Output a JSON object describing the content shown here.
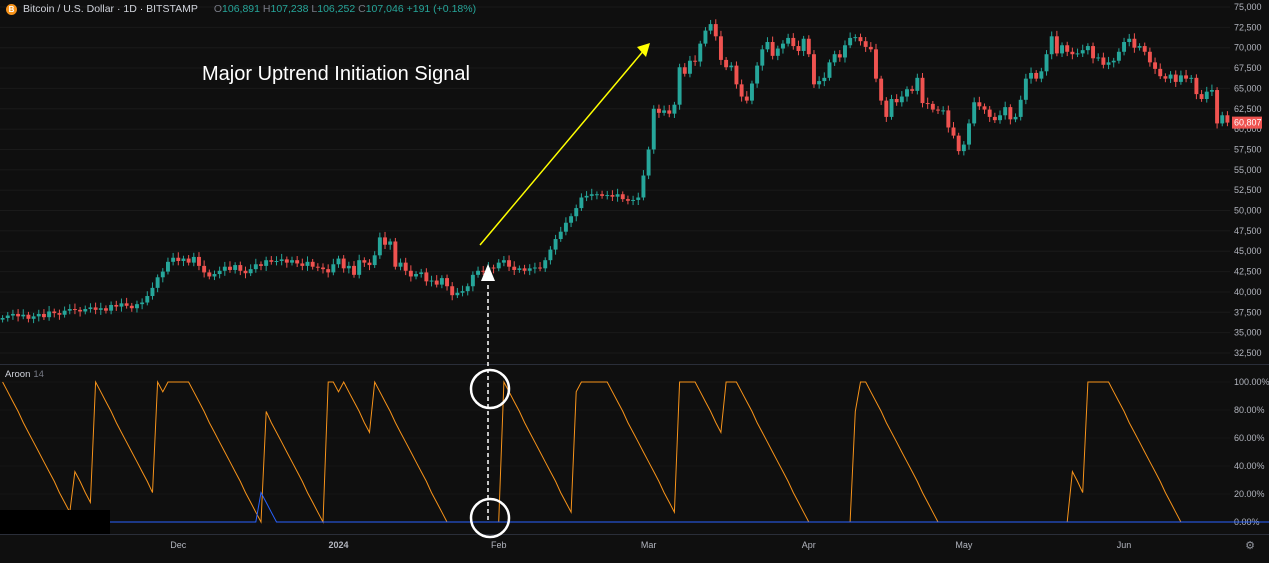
{
  "header": {
    "symbol": "Bitcoin / U.S. Dollar · 1D · BITSTAMP",
    "logo": "B",
    "open_key": "O",
    "open": "106,891",
    "high_key": "H",
    "high": "107,238",
    "low_key": "L",
    "low": "106,252",
    "close_key": "C",
    "close": "107,046",
    "change": "+191 (+0.18%)"
  },
  "annotation": {
    "title": "Major Uptrend Initiation Signal"
  },
  "aroon": {
    "label": "Aroon",
    "length": "14"
  },
  "icons": {
    "settings": "gear-icon"
  },
  "colors": {
    "background": "#0f0f0f",
    "up": "#26a69a",
    "down": "#ef5350",
    "aroon_up": "#f7931a",
    "aroon_down": "#2962ff",
    "arrow": "#ffff00",
    "last_price_bg": "#ef5350"
  },
  "chart_data": [
    {
      "type": "candlestick",
      "series_name": "Bitcoin / U.S. Dollar",
      "x_axis_labels": [
        "Dec",
        "2024",
        "Feb",
        "Mar",
        "Apr",
        "May",
        "Jun"
      ],
      "y_ticks": [
        32500,
        35000,
        37500,
        40000,
        42500,
        45000,
        47500,
        50000,
        52500,
        55000,
        57500,
        60000,
        62500,
        65000,
        67500,
        70000,
        72500,
        75000
      ],
      "y_tick_labels": [
        "32,500",
        "35,000",
        "37,500",
        "40,000",
        "42,500",
        "45,000",
        "47,500",
        "50,000",
        "52,500",
        "55,000",
        "57,500",
        "60,000",
        "62,500",
        "65,000",
        "67,500",
        "70,000",
        "72,500",
        "75,000"
      ],
      "ylim": [
        31000,
        77000
      ],
      "last_price": "60,807",
      "closes": [
        36800,
        37100,
        37300,
        37000,
        37200,
        36700,
        37000,
        37300,
        36900,
        37600,
        37400,
        37200,
        37700,
        37900,
        37800,
        37600,
        37900,
        38100,
        37800,
        38000,
        37700,
        38400,
        38200,
        38600,
        38300,
        38000,
        38500,
        38700,
        39500,
        40500,
        41800,
        42500,
        43700,
        44200,
        43800,
        44100,
        43600,
        44300,
        43200,
        42400,
        41900,
        42200,
        42600,
        43100,
        42700,
        43300,
        42600,
        42300,
        42800,
        43400,
        43200,
        43900,
        43700,
        43800,
        44000,
        43600,
        43900,
        43500,
        43200,
        43700,
        43100,
        43000,
        42800,
        42400,
        43400,
        44100,
        42900,
        43200,
        42100,
        43900,
        43600,
        43300,
        44500,
        46700,
        45800,
        46200,
        43100,
        43600,
        42600,
        41900,
        42200,
        42400,
        41300,
        41400,
        40900,
        41700,
        40700,
        39600,
        39900,
        40100,
        40700,
        42100,
        42600,
        42500,
        43000,
        42900,
        43600,
        43900,
        43100,
        42700,
        42900,
        42600,
        42900,
        43000,
        42900,
        43900,
        45200,
        46500,
        47400,
        48500,
        49300,
        50300,
        51600,
        51800,
        52000,
        52000,
        51800,
        51900,
        51700,
        52000,
        51400,
        51200,
        51300,
        51600,
        54300,
        57500,
        62500,
        62000,
        62300,
        61900,
        63000,
        67600,
        66800,
        68400,
        68300,
        70500,
        72100,
        72900,
        71400,
        68500,
        67600,
        67800,
        65500,
        64000,
        63500,
        65600,
        67800,
        69800,
        70700,
        69000,
        69900,
        70500,
        71200,
        70200,
        69600,
        71100,
        69200,
        65500,
        65900,
        66300,
        68200,
        69200,
        68800,
        70300,
        71200,
        71300,
        70800,
        70100,
        69800,
        66200,
        63500,
        61500,
        63700,
        63300,
        64000,
        64900,
        64700,
        66300,
        63200,
        63100,
        62400,
        62300,
        62300,
        60200,
        59200,
        57300,
        58100,
        60700,
        63300,
        62800,
        62400,
        61500,
        61100,
        61700,
        62700,
        61200,
        61500,
        63600,
        66200,
        66900,
        66200,
        67100,
        69200,
        71400,
        69300,
        70300,
        69500,
        69200,
        69300,
        69700,
        70200,
        68700,
        68800,
        67900,
        68200,
        68400,
        69500,
        70700,
        71100,
        70000,
        70200,
        69500,
        68200,
        67400,
        66500,
        66200,
        66700,
        65800,
        66600,
        66200,
        66300,
        64300,
        63700,
        64600,
        64800,
        60700,
        61700,
        60800
      ],
      "xlabel": "",
      "ylabel": ""
    },
    {
      "type": "line",
      "title": "Aroon 14",
      "y_ticks": [
        0,
        20,
        40,
        60,
        80,
        100
      ],
      "y_tick_labels": [
        "0.00%",
        "20.00%",
        "40.00%",
        "60.00%",
        "80.00%",
        "100.00%"
      ],
      "ylim": [
        -8,
        108
      ],
      "series": [
        {
          "name": "Aroon Up",
          "color": "#f7931a",
          "values": [
            100,
            93,
            86,
            79,
            71,
            64,
            57,
            50,
            43,
            36,
            29,
            21,
            14,
            7,
            36,
            29,
            21,
            14,
            100,
            93,
            86,
            79,
            71,
            64,
            57,
            50,
            43,
            36,
            29,
            21,
            100,
            93,
            100,
            100,
            100,
            100,
            100,
            93,
            86,
            79,
            71,
            64,
            57,
            50,
            43,
            36,
            29,
            21,
            14,
            7,
            0,
            79,
            71,
            64,
            57,
            50,
            43,
            36,
            29,
            21,
            14,
            7,
            0,
            100,
            100,
            93,
            100,
            93,
            86,
            79,
            71,
            64,
            100,
            93,
            86,
            79,
            71,
            64,
            57,
            50,
            43,
            36,
            29,
            21,
            14,
            7,
            0,
            0,
            0,
            0,
            0,
            0,
            0,
            0,
            0,
            0,
            0,
            100,
            93,
            86,
            79,
            71,
            64,
            57,
            50,
            43,
            36,
            29,
            21,
            14,
            7,
            93,
            100,
            100,
            100,
            100,
            100,
            100,
            93,
            86,
            79,
            71,
            64,
            57,
            50,
            43,
            36,
            29,
            21,
            14,
            7,
            100,
            100,
            100,
            100,
            93,
            86,
            79,
            71,
            64,
            100,
            100,
            100,
            93,
            86,
            79,
            71,
            64,
            57,
            50,
            43,
            36,
            29,
            21,
            14,
            7,
            0,
            0,
            0,
            0,
            0,
            0,
            0,
            0,
            0,
            79,
            100,
            100,
            93,
            86,
            79,
            71,
            64,
            57,
            50,
            43,
            36,
            29,
            21,
            14,
            7,
            0,
            0,
            0,
            0,
            0,
            0,
            0,
            0,
            0,
            0,
            0,
            0,
            0,
            0,
            0,
            0,
            0,
            0,
            0,
            0,
            0,
            0,
            0,
            0,
            0,
            0,
            36,
            29,
            21,
            100,
            100,
            100,
            100,
            100,
            93,
            86,
            79,
            71,
            64,
            57,
            50,
            43,
            36,
            29,
            21,
            14,
            7,
            0,
            0,
            0,
            0,
            0,
            0,
            0,
            0,
            0,
            0,
            0,
            0,
            0,
            0,
            0,
            0,
            0,
            0,
            0,
            0,
            0,
            0,
            0,
            0,
            0,
            0
          ]
        },
        {
          "name": "Aroon Down",
          "color": "#2962ff",
          "values": [
            7,
            0,
            0,
            0,
            0,
            0,
            0,
            0,
            0,
            0,
            0,
            0,
            0,
            0,
            0,
            0,
            0,
            0,
            0,
            0,
            0,
            0,
            0,
            0,
            0,
            0,
            0,
            0,
            0,
            0,
            0,
            0,
            0,
            0,
            0,
            0,
            0,
            0,
            0,
            0,
            0,
            0,
            0,
            0,
            0,
            0,
            0,
            0,
            0,
            0,
            21,
            14,
            7,
            0,
            0,
            0,
            0,
            0,
            0,
            0,
            0,
            0,
            0,
            0,
            0,
            0,
            0,
            0,
            0,
            0,
            0,
            0,
            0,
            0,
            0,
            0,
            0,
            0,
            0,
            0,
            0,
            0,
            0,
            0,
            0,
            0,
            0,
            0,
            0,
            0,
            0,
            0,
            0,
            0,
            0,
            0,
            0,
            0,
            0,
            0,
            0,
            0,
            0,
            0,
            0,
            0,
            0,
            0,
            0,
            0,
            0,
            0,
            0,
            0,
            0,
            0,
            0,
            0,
            0,
            0,
            0,
            0,
            0,
            0,
            0,
            0,
            0,
            0,
            0,
            0,
            0,
            0,
            0,
            0,
            0,
            0,
            0,
            0,
            0,
            0,
            0,
            0,
            0,
            0,
            0,
            0,
            0,
            0,
            0,
            0,
            0,
            0,
            0,
            0,
            0,
            0,
            0,
            0,
            0,
            0,
            0,
            0,
            0,
            0,
            0,
            0,
            0,
            0,
            0,
            0,
            0,
            0,
            0,
            0,
            0,
            0,
            0,
            0,
            0,
            0,
            0,
            0,
            0,
            0,
            0,
            0,
            0,
            0,
            0,
            0,
            0,
            0,
            0,
            0,
            0,
            0,
            0,
            0,
            0,
            0,
            0,
            0,
            0,
            0,
            0,
            0,
            0,
            0,
            0,
            0,
            0,
            0,
            0,
            0,
            0,
            0,
            0,
            0,
            0,
            0,
            0,
            0,
            0,
            0,
            0,
            0,
            0,
            0,
            0,
            0,
            0,
            0,
            0,
            0,
            0,
            0,
            0,
            0,
            0,
            0,
            0,
            0,
            0,
            0,
            0,
            0,
            0,
            0,
            0,
            0,
            0,
            0,
            0,
            0,
            0,
            0,
            0
          ]
        }
      ]
    }
  ]
}
